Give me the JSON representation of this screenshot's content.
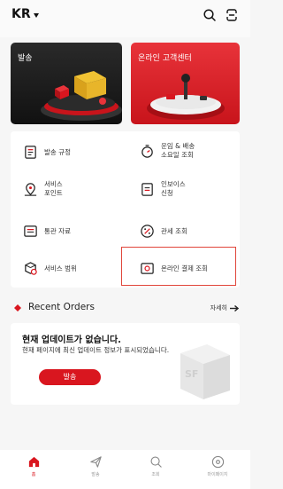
{
  "header": {
    "region": "KR",
    "icons": [
      "search-icon",
      "profile-icon"
    ]
  },
  "banners": [
    {
      "title": "발송",
      "color": "#1a1a1a"
    },
    {
      "title": "온라인 고객센터",
      "color": "#d9161f"
    }
  ],
  "menu": [
    {
      "label": "발송 규정",
      "icon": "document-icon"
    },
    {
      "label": "운임 & 배송\n소요일 조회",
      "icon": "timer-icon"
    },
    {
      "label": "서비스\n포인트",
      "icon": "location-pin-icon"
    },
    {
      "label": "인보이스\n신청",
      "icon": "invoice-icon"
    },
    {
      "label": "통관 자료",
      "icon": "folder-icon"
    },
    {
      "label": "관세 조회",
      "icon": "percent-icon"
    },
    {
      "label": "서비스 범위",
      "icon": "box-location-icon"
    },
    {
      "label": "온라인 결제 조회",
      "icon": "card-payment-icon"
    }
  ],
  "recent": {
    "title": "Recent Orders",
    "more": "자세히",
    "empty_title": "현재 업데이트가 없습니다.",
    "empty_desc": "현재 페이지에 최신 업데이트 정보가 표시되었습니다.",
    "button": "발송"
  },
  "nav": [
    {
      "label": "홈",
      "icon": "home-icon",
      "active": true
    },
    {
      "label": "발송",
      "icon": "paper-plane-icon",
      "active": false
    },
    {
      "label": "조회",
      "icon": "search-icon",
      "active": false
    },
    {
      "label": "마이페이지",
      "icon": "user-icon",
      "active": false
    }
  ],
  "colors": {
    "accent": "#d9161f",
    "dark": "#1a1a1a",
    "background": "#f6f6f6"
  }
}
